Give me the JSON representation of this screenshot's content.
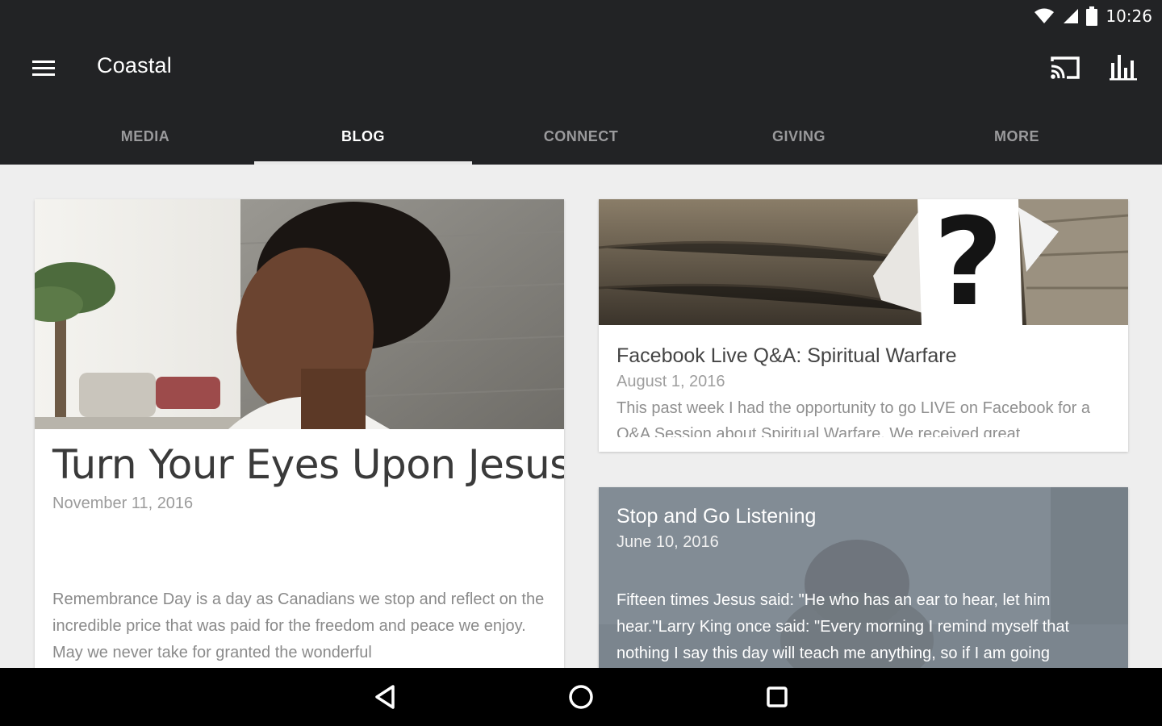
{
  "status_bar": {
    "time": "10:26",
    "icons": [
      "wifi-icon",
      "signal-icon",
      "battery-icon"
    ]
  },
  "app_bar": {
    "title": "Coastal",
    "icons": [
      "menu-icon",
      "cast-icon",
      "stats-icon"
    ]
  },
  "tabs": [
    {
      "label": "MEDIA"
    },
    {
      "label": "BLOG",
      "active": true
    },
    {
      "label": "CONNECT"
    },
    {
      "label": "GIVING"
    },
    {
      "label": "MORE"
    }
  ],
  "posts": [
    {
      "title": "Turn Your Eyes Upon Jesus",
      "date": "November 11, 2016",
      "excerpt": "Remembrance Day is a day as Canadians we stop and reflect on the incredible price that was paid for the freedom and peace we enjoy. May we never take for granted the wonderful"
    },
    {
      "title": "Facebook Live Q&A: Spiritual Warfare",
      "date": "August 1, 2016",
      "excerpt": "This past week I had the opportunity to go LIVE on Facebook for a Q&A Session about Spiritual Warfare. We received great"
    },
    {
      "title": "Stop and Go Listening",
      "date": "June 10, 2016",
      "excerpt": "Fifteen times Jesus said: \"He who has an ear to hear, let him hear.\"Larry King once said: \"Every morning I remind myself that nothing I say this day will teach me anything, so if I am going"
    }
  ],
  "nav_bar": {
    "buttons": [
      "back-icon",
      "home-icon",
      "recents-icon"
    ]
  },
  "colors": {
    "bar": "#222325",
    "background": "#eeeeee",
    "card": "#ffffff",
    "tab_inactive": "#9a9a9c"
  }
}
